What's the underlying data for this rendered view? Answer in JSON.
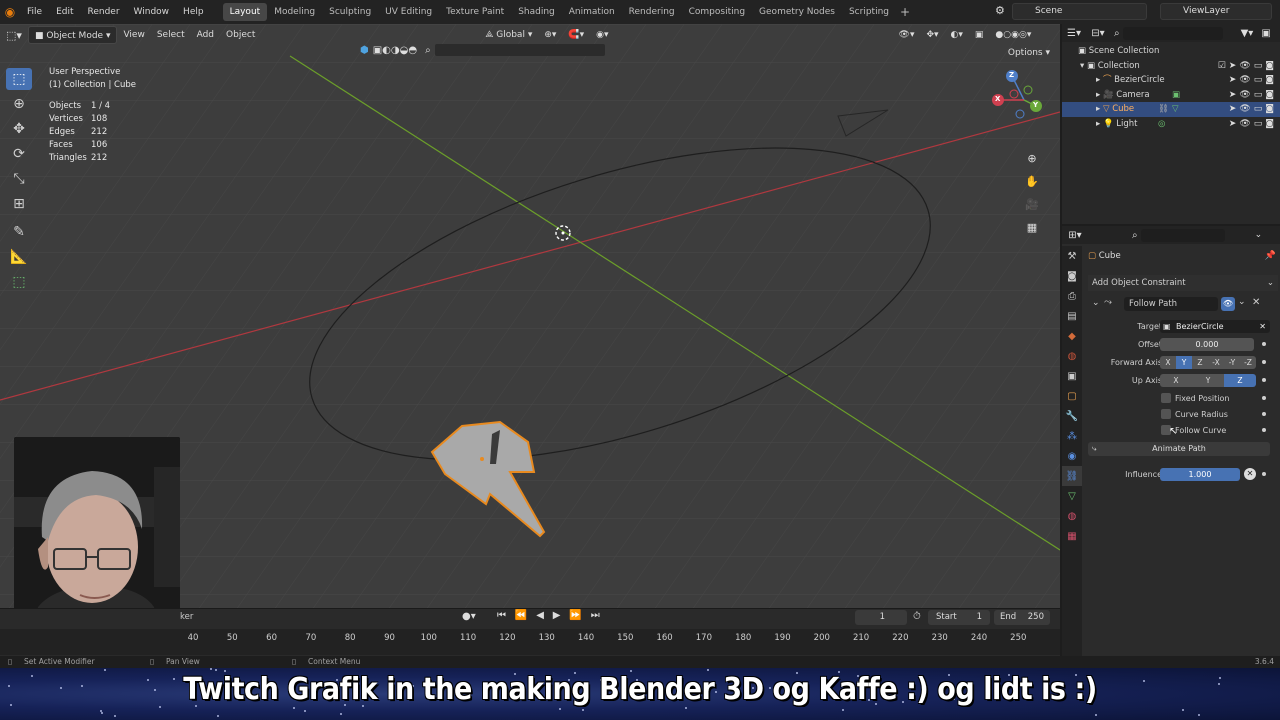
{
  "topbar": {
    "menus": [
      "File",
      "Edit",
      "Render",
      "Window",
      "Help"
    ],
    "workspaces": [
      "Layout",
      "Modeling",
      "Sculpting",
      "UV Editing",
      "Texture Paint",
      "Shading",
      "Animation",
      "Rendering",
      "Compositing",
      "Geometry Nodes",
      "Scripting"
    ],
    "active_workspace": "Layout",
    "add_workspace": "+",
    "scene": "Scene",
    "view_layer": "ViewLayer"
  },
  "viewport": {
    "mode": "Object Mode",
    "menus": [
      "View",
      "Select",
      "Add",
      "Object"
    ],
    "orientation": "Global",
    "options": "Options",
    "title": "User Perspective",
    "subtitle": "(1) Collection | Cube",
    "stats": [
      {
        "label": "Objects",
        "value": "1 / 4"
      },
      {
        "label": "Vertices",
        "value": "108"
      },
      {
        "label": "Edges",
        "value": "212"
      },
      {
        "label": "Faces",
        "value": "106"
      },
      {
        "label": "Triangles",
        "value": "212"
      }
    ],
    "gizmo": {
      "x": "X",
      "y": "Y",
      "z": "Z"
    }
  },
  "timeline": {
    "partial_label": "ker",
    "current_frame": "1",
    "start_label": "Start",
    "start": "1",
    "end_label": "End",
    "end": "250",
    "ticks": [
      "40",
      "50",
      "60",
      "70",
      "80",
      "90",
      "100",
      "110",
      "120",
      "130",
      "140",
      "150",
      "160",
      "170",
      "180",
      "190",
      "200",
      "210",
      "220",
      "230",
      "240",
      "250"
    ]
  },
  "statusbar": {
    "left": "Set Active Modifier",
    "middle": "Pan View",
    "right": "Context Menu",
    "version": "3.6.4"
  },
  "outliner": {
    "root": "Scene Collection",
    "collection": "Collection",
    "items": [
      {
        "name": "BezierCircle",
        "icon_color": "#e8a050",
        "selected": false
      },
      {
        "name": "Camera",
        "icon_color": "#e8a050",
        "selected": false
      },
      {
        "name": "Cube",
        "icon_color": "#e8a050",
        "selected": true
      },
      {
        "name": "Light",
        "icon_color": "#e8a050",
        "selected": false
      }
    ]
  },
  "properties": {
    "object_name": "Cube",
    "add_constraint": "Add Object Constraint",
    "constraint_name": "Follow Path",
    "target_label": "Target",
    "target_value": "BezierCircle",
    "offset_label": "Offset",
    "offset_value": "0.000",
    "forward_axis_label": "Forward Axis",
    "forward_axes": [
      "X",
      "Y",
      "Z",
      "-X",
      "-Y",
      "-Z"
    ],
    "forward_axis_active": "Y",
    "up_axis_label": "Up Axis",
    "up_axes": [
      "X",
      "Y",
      "Z"
    ],
    "up_axis_active": "Z",
    "fixed_position": "Fixed Position",
    "curve_radius": "Curve Radius",
    "follow_curve": "Follow Curve",
    "animate_path": "Animate Path",
    "influence_label": "Influence",
    "influence_value": "1.000"
  },
  "banner": {
    "text": "Twitch Grafik in the making Blender 3D og Kaffe :) og lidt is :)"
  }
}
